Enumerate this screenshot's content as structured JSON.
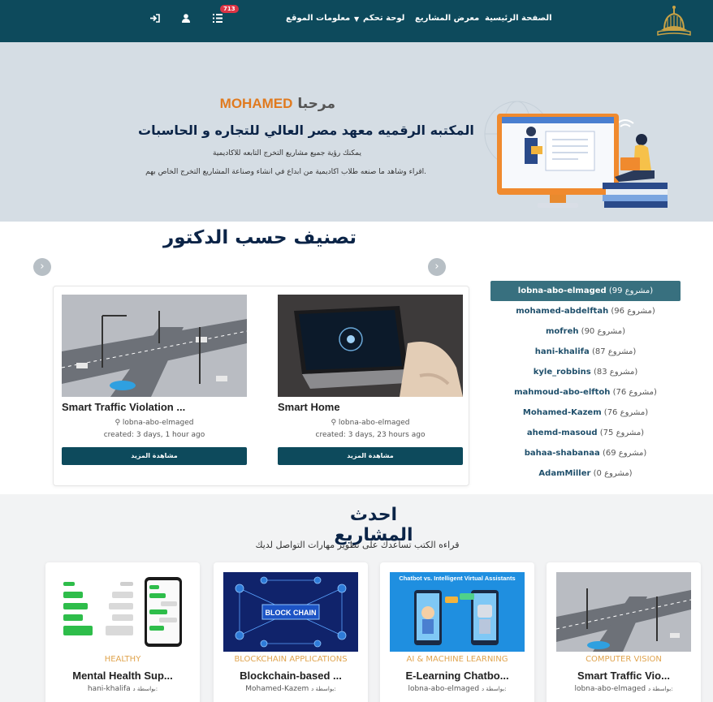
{
  "navbar": {
    "links": [
      "الصفحة الرئيسية",
      "معرض المشاريع",
      "لوحة تحكم",
      "معلومات الموقع"
    ],
    "badge": "713"
  },
  "hero": {
    "greeting": "مرحبا",
    "username": "MOHAMED",
    "title": "المكتبه الرقميه معهد مصر العالي للتجاره و الحاسبات",
    "subtitle1": "يمكنك رؤية جميع مشاريع التخرج التابعه للاكاديمية",
    "subtitle2": "اقراء وشاهد ما صنعه طلاب اكاديمية من ابداع في انشاء وصناعة المشاريع التخرج الخاص بهم."
  },
  "doctor_section": {
    "title": "تصنيف حسب الدكتور",
    "doctors": [
      {
        "name": "lobna-abo-elmaged",
        "count": "(99 مشروع)"
      },
      {
        "name": "mohamed-abdelftah",
        "count": "(96 مشروع)"
      },
      {
        "name": "mofreh",
        "count": "(90 مشروع)"
      },
      {
        "name": "hani-khalifa",
        "count": "(87 مشروع)"
      },
      {
        "name": "kyle_robbins",
        "count": "(83 مشروع)"
      },
      {
        "name": "mahmoud-abo-elftoh",
        "count": "(76 مشروع)"
      },
      {
        "name": "Mohamed-Kazem",
        "count": "(76 مشروع)"
      },
      {
        "name": "ahemd-masoud",
        "count": "(75 مشروع)"
      },
      {
        "name": "bahaa-shabanaa",
        "count": "(69 مشروع)"
      },
      {
        "name": "AdamMiller",
        "count": "(0 مشروع)"
      }
    ],
    "cards": [
      {
        "title": "Smart Home",
        "author": "lobna-abo-elmaged",
        "created": "created: 3 days, 23 hours ago",
        "button": "مشاهدة المزيد"
      },
      {
        "title": "Smart Traffic Violation ...",
        "author": "lobna-abo-elmaged",
        "created": "created: 3 days, 1 hour ago",
        "button": "مشاهدة المزيد"
      }
    ]
  },
  "latest": {
    "title": "احدث المشاريع",
    "subtitle": "قراءه الكتب تساعدك على تطوير مهارات التواصل لديك",
    "by_label": "بواسطة د:",
    "cards": [
      {
        "category": "COMPUTER VISION",
        "title": "Smart Traffic Vio...",
        "author": "lobna-abo-elmaged"
      },
      {
        "category": "AI & MACHINE LEARNING",
        "title": "E-Learning Chatbo...",
        "author": "lobna-abo-elmaged",
        "image_caption": "Chatbot vs. Intelligent Virtual Assistants"
      },
      {
        "category": "BLOCKCHAIN APPLICATIONS",
        "title": "Blockchain-based ...",
        "author": "Mohamed-Kazem",
        "image_caption": "BLOCK CHAIN"
      },
      {
        "category": "HEALTHY",
        "title": "Mental Health Sup...",
        "author": "hani-khalifa"
      }
    ]
  },
  "colors": {
    "navbar": "#0d4a5c",
    "hero_bg": "#d5dde4",
    "accent_orange": "#e07a1f",
    "title_navy": "#0b2447",
    "active_doctor": "#38707f"
  },
  "icons": [
    "logo-icon",
    "logout-icon",
    "user-icon",
    "list-icon",
    "caret-down-icon",
    "chevron-right-icon"
  ]
}
